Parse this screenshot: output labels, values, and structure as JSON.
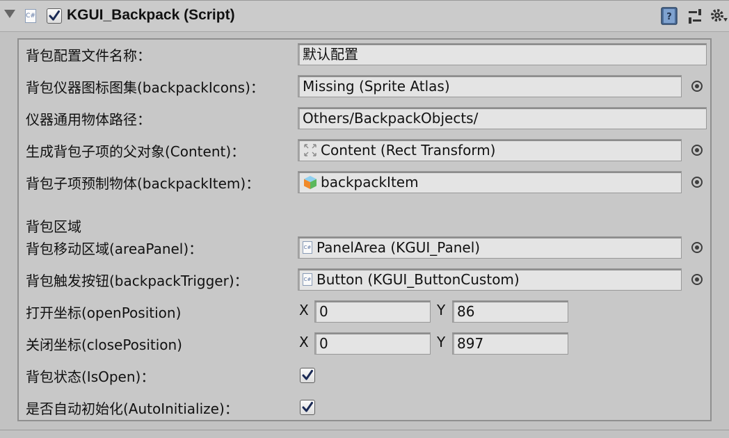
{
  "component": {
    "title": "KGUI_Backpack (Script)",
    "script_icon_text": "C#",
    "enabled": true,
    "icons": [
      "help-book-icon",
      "presets-icon",
      "settings-gear-icon"
    ]
  },
  "fields": {
    "config_name": {
      "label": "背包配置文件名称：",
      "value": "默认配置"
    },
    "icons_atlas": {
      "label": "背包仪器图标图集(backpackIcons)：",
      "value": "Missing (Sprite Atlas)"
    },
    "objects_path": {
      "label": "仪器通用物体路径：",
      "value": "Others/BackpackObjects/"
    },
    "content": {
      "label": "生成背包子项的父对象(Content)：",
      "value": "Content (Rect Transform)"
    },
    "item_prefab": {
      "label": "背包子项预制物体(backpackItem)：",
      "value": "backpackItem"
    },
    "section_title": "背包区域",
    "area_panel": {
      "label": "背包移动区域(areaPanel)：",
      "value": "PanelArea (KGUI_Panel)"
    },
    "trigger": {
      "label": "背包触发按钮(backpackTrigger)：",
      "value": "Button (KGUI_ButtonCustom)"
    },
    "open_position": {
      "label": "打开坐标(openPosition)",
      "x_label": "X",
      "x": "0",
      "y_label": "Y",
      "y": "86"
    },
    "close_position": {
      "label": "关闭坐标(closePosition)",
      "x_label": "X",
      "x": "0",
      "y_label": "Y",
      "y": "897"
    },
    "is_open": {
      "label": "背包状态(IsOpen)：",
      "checked": true
    },
    "auto_init": {
      "label": "是否自动初始化(AutoInitialize)：",
      "checked": true
    }
  },
  "colors": {
    "background": "#c2c2c2",
    "field": "#e4e4e4",
    "checkbox_mark": "#1a2a55"
  }
}
